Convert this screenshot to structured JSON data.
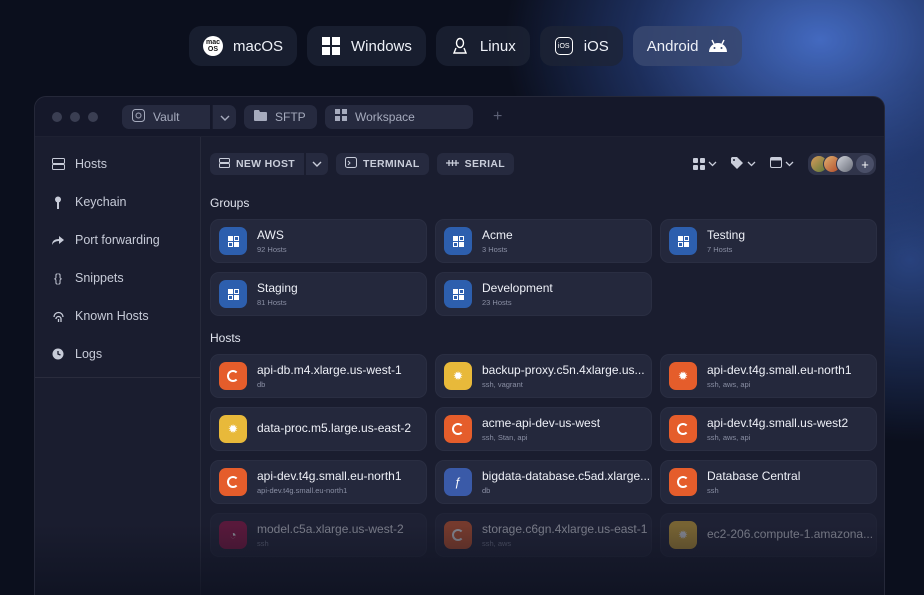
{
  "os_selector": [
    {
      "label": "macOS",
      "icon": "macos-icon",
      "icon_text": "mac\nOS"
    },
    {
      "label": "Windows",
      "icon": "windows-icon"
    },
    {
      "label": "Linux",
      "icon": "linux-icon"
    },
    {
      "label": "iOS",
      "icon": "ios-icon",
      "icon_text": "iOS"
    },
    {
      "label": "Android",
      "icon": "android-icon",
      "active": true
    }
  ],
  "titlebar": {
    "tabs": {
      "vault": "Vault",
      "sftp": "SFTP",
      "workspace": "Workspace"
    },
    "plus": "+"
  },
  "sidebar": {
    "items": [
      {
        "label": "Hosts",
        "icon": "server-icon"
      },
      {
        "label": "Keychain",
        "icon": "key-icon"
      },
      {
        "label": "Port forwarding",
        "icon": "forward-icon"
      },
      {
        "label": "Snippets",
        "icon": "braces-icon"
      },
      {
        "label": "Known Hosts",
        "icon": "fingerprint-icon"
      },
      {
        "label": "Logs",
        "icon": "clock-icon"
      }
    ]
  },
  "toolbar": {
    "new_host": "NEW HOST",
    "terminal": "TERMINAL",
    "serial": "SERIAL",
    "plus": "+"
  },
  "groups": {
    "title": "Groups",
    "items": [
      {
        "name": "AWS",
        "count": "92 Hosts"
      },
      {
        "name": "Acme",
        "count": "3 Hosts"
      },
      {
        "name": "Testing",
        "count": "7 Hosts"
      },
      {
        "name": "Staging",
        "count": "81 Hosts"
      },
      {
        "name": "Development",
        "count": "23 Hosts"
      }
    ]
  },
  "hosts": {
    "title": "Hosts",
    "items": [
      {
        "name": "api-db.m4.xlarge.us-west-1",
        "tags": "db",
        "icon": "ubuntu-icon"
      },
      {
        "name": "backup-proxy.c5n.4xlarge.us...",
        "tags": "ssh, vagrant",
        "icon": "yellow-os-icon"
      },
      {
        "name": "api-dev.t4g.small.eu-north1",
        "tags": "ssh, aws, api",
        "icon": "ubuntu-icon"
      },
      {
        "name": "data-proc.m5.large.us-east-2",
        "tags": "",
        "icon": "yellow-os-icon"
      },
      {
        "name": "acme-api-dev-us-west",
        "tags": "ssh, Stan, api",
        "icon": "ubuntu-icon"
      },
      {
        "name": "api-dev.t4g.small.us-west2",
        "tags": "ssh, aws, api",
        "icon": "ubuntu-icon"
      },
      {
        "name": "api-dev.t4g.small.eu-north1",
        "tags": "api-dev.t4g.small.eu-north1",
        "icon": "ubuntu-icon"
      },
      {
        "name": "bigdata-database.c5ad.xlarge...",
        "tags": "db",
        "icon": "fedora-icon"
      },
      {
        "name": "Database Central",
        "tags": "ssh",
        "icon": "ubuntu-icon"
      },
      {
        "name": "model.c5a.xlarge.us-west-2",
        "tags": "ssh",
        "icon": "debian-icon"
      },
      {
        "name": "storage.c6gn.4xlarge.us-east-1",
        "tags": "ssh, aws",
        "icon": "ubuntu-icon"
      },
      {
        "name": "ec2-206.compute-1.amazona...",
        "tags": "",
        "icon": "yellow-os-icon"
      }
    ]
  }
}
